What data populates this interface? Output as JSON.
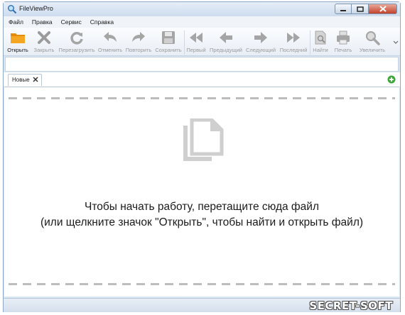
{
  "window": {
    "title": "FileViewPro",
    "icon": "magnifier-icon"
  },
  "menu": {
    "items": [
      "Файл",
      "Правка",
      "Сервис",
      "Справка"
    ]
  },
  "toolbar": {
    "buttons": [
      {
        "label": "Открыть",
        "icon": "folder-icon",
        "enabled": true
      },
      {
        "label": "Закрыть",
        "icon": "close-x-icon",
        "enabled": false
      },
      {
        "label": "Перезагрузить",
        "icon": "reload-icon",
        "enabled": false
      },
      {
        "label": "Отменить",
        "icon": "undo-icon",
        "enabled": false
      },
      {
        "label": "Повторить",
        "icon": "redo-icon",
        "enabled": false
      },
      {
        "label": "Сохранить",
        "icon": "save-icon",
        "enabled": false
      },
      {
        "label": "Первый",
        "icon": "first-icon",
        "enabled": false
      },
      {
        "label": "Предыдущий",
        "icon": "previous-icon",
        "enabled": false
      },
      {
        "label": "Следующий",
        "icon": "next-icon",
        "enabled": false
      },
      {
        "label": "Последний",
        "icon": "last-icon",
        "enabled": false
      },
      {
        "label": "Найти",
        "icon": "find-icon",
        "enabled": false
      },
      {
        "label": "Печать",
        "icon": "print-icon",
        "enabled": false
      },
      {
        "label": "Увеличить",
        "icon": "zoom-icon",
        "enabled": false
      }
    ]
  },
  "tabs": [
    {
      "label": "Новые",
      "active": true
    }
  ],
  "content": {
    "line1": "Чтобы начать работу, перетащите сюда файл",
    "line2": "(или щелкните значок \"Открыть\", чтобы найти и открыть файл)",
    "icon": "documents-icon"
  },
  "watermark": "SECRET-SOFT",
  "colors": {
    "accent": "#f0a21a",
    "disabled_icon": "#a8a8a8",
    "add_tab": "#3fa63a"
  }
}
